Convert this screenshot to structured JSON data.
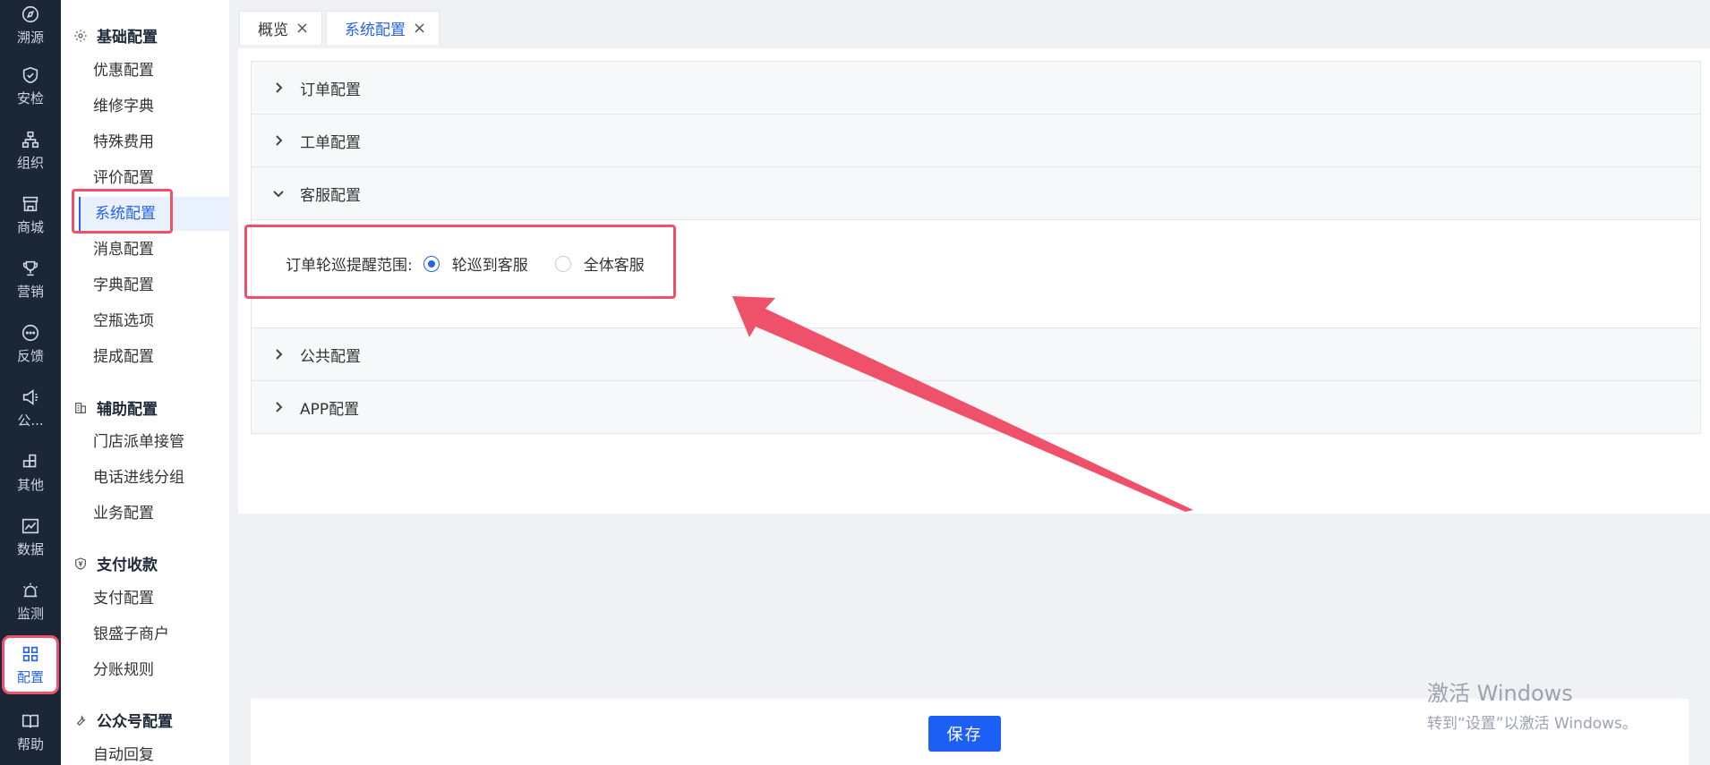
{
  "rail": {
    "items": [
      {
        "label": "溯源",
        "icon": "compass-icon"
      },
      {
        "label": "安检",
        "icon": "shield-check-icon"
      },
      {
        "label": "组织",
        "icon": "org-chart-icon"
      },
      {
        "label": "商城",
        "icon": "store-icon"
      },
      {
        "label": "营销",
        "icon": "trophy-icon"
      },
      {
        "label": "反馈",
        "icon": "chat-bubble-icon"
      },
      {
        "label": "公...",
        "icon": "megaphone-icon"
      },
      {
        "label": "其他",
        "icon": "blocks-icon"
      },
      {
        "label": "数据",
        "icon": "line-chart-icon"
      },
      {
        "label": "监测",
        "icon": "alarm-light-icon"
      },
      {
        "label": "配置",
        "icon": "grid-icon"
      },
      {
        "label": "帮助",
        "icon": "book-icon"
      }
    ],
    "active": "配置"
  },
  "submenu": {
    "groups": [
      {
        "title": "基础配置",
        "icon": "gear-icon",
        "items": [
          "优惠配置",
          "维修字典",
          "特殊费用",
          "评价配置",
          "系统配置",
          "消息配置",
          "字典配置",
          "空瓶选项",
          "提成配置"
        ]
      },
      {
        "title": "辅助配置",
        "icon": "building-icon",
        "items": [
          "门店派单接管",
          "电话进线分组",
          "业务配置"
        ]
      },
      {
        "title": "支付收款",
        "icon": "yen-shield-icon",
        "items": [
          "支付配置",
          "银盛子商户",
          "分账规则"
        ]
      },
      {
        "title": "公众号配置",
        "icon": "wrench-icon",
        "items": [
          "自动回复"
        ]
      }
    ],
    "active_item": "系统配置"
  },
  "tabs": [
    {
      "label": "概览",
      "active": false
    },
    {
      "label": "系统配置",
      "active": true
    }
  ],
  "tab_close_glyph": "×",
  "sections": [
    {
      "title": "订单配置",
      "expanded": false
    },
    {
      "title": "工单配置",
      "expanded": false
    },
    {
      "title": "客服配置",
      "expanded": true
    },
    {
      "title": "公共配置",
      "expanded": false
    },
    {
      "title": "APP配置",
      "expanded": false
    }
  ],
  "customer_service": {
    "field_label": "订单轮巡提醒范围:",
    "options": [
      {
        "label": "轮巡到客服",
        "checked": true
      },
      {
        "label": "全体客服",
        "checked": false
      }
    ]
  },
  "footer": {
    "save_label": "保存"
  },
  "watermark": {
    "line1": "激活 Windows",
    "line2": "转到“设置”以激活 Windows。"
  },
  "colors": {
    "primary": "#2563eb",
    "highlight": "#f0516a",
    "rail_bg": "#1b2636"
  }
}
